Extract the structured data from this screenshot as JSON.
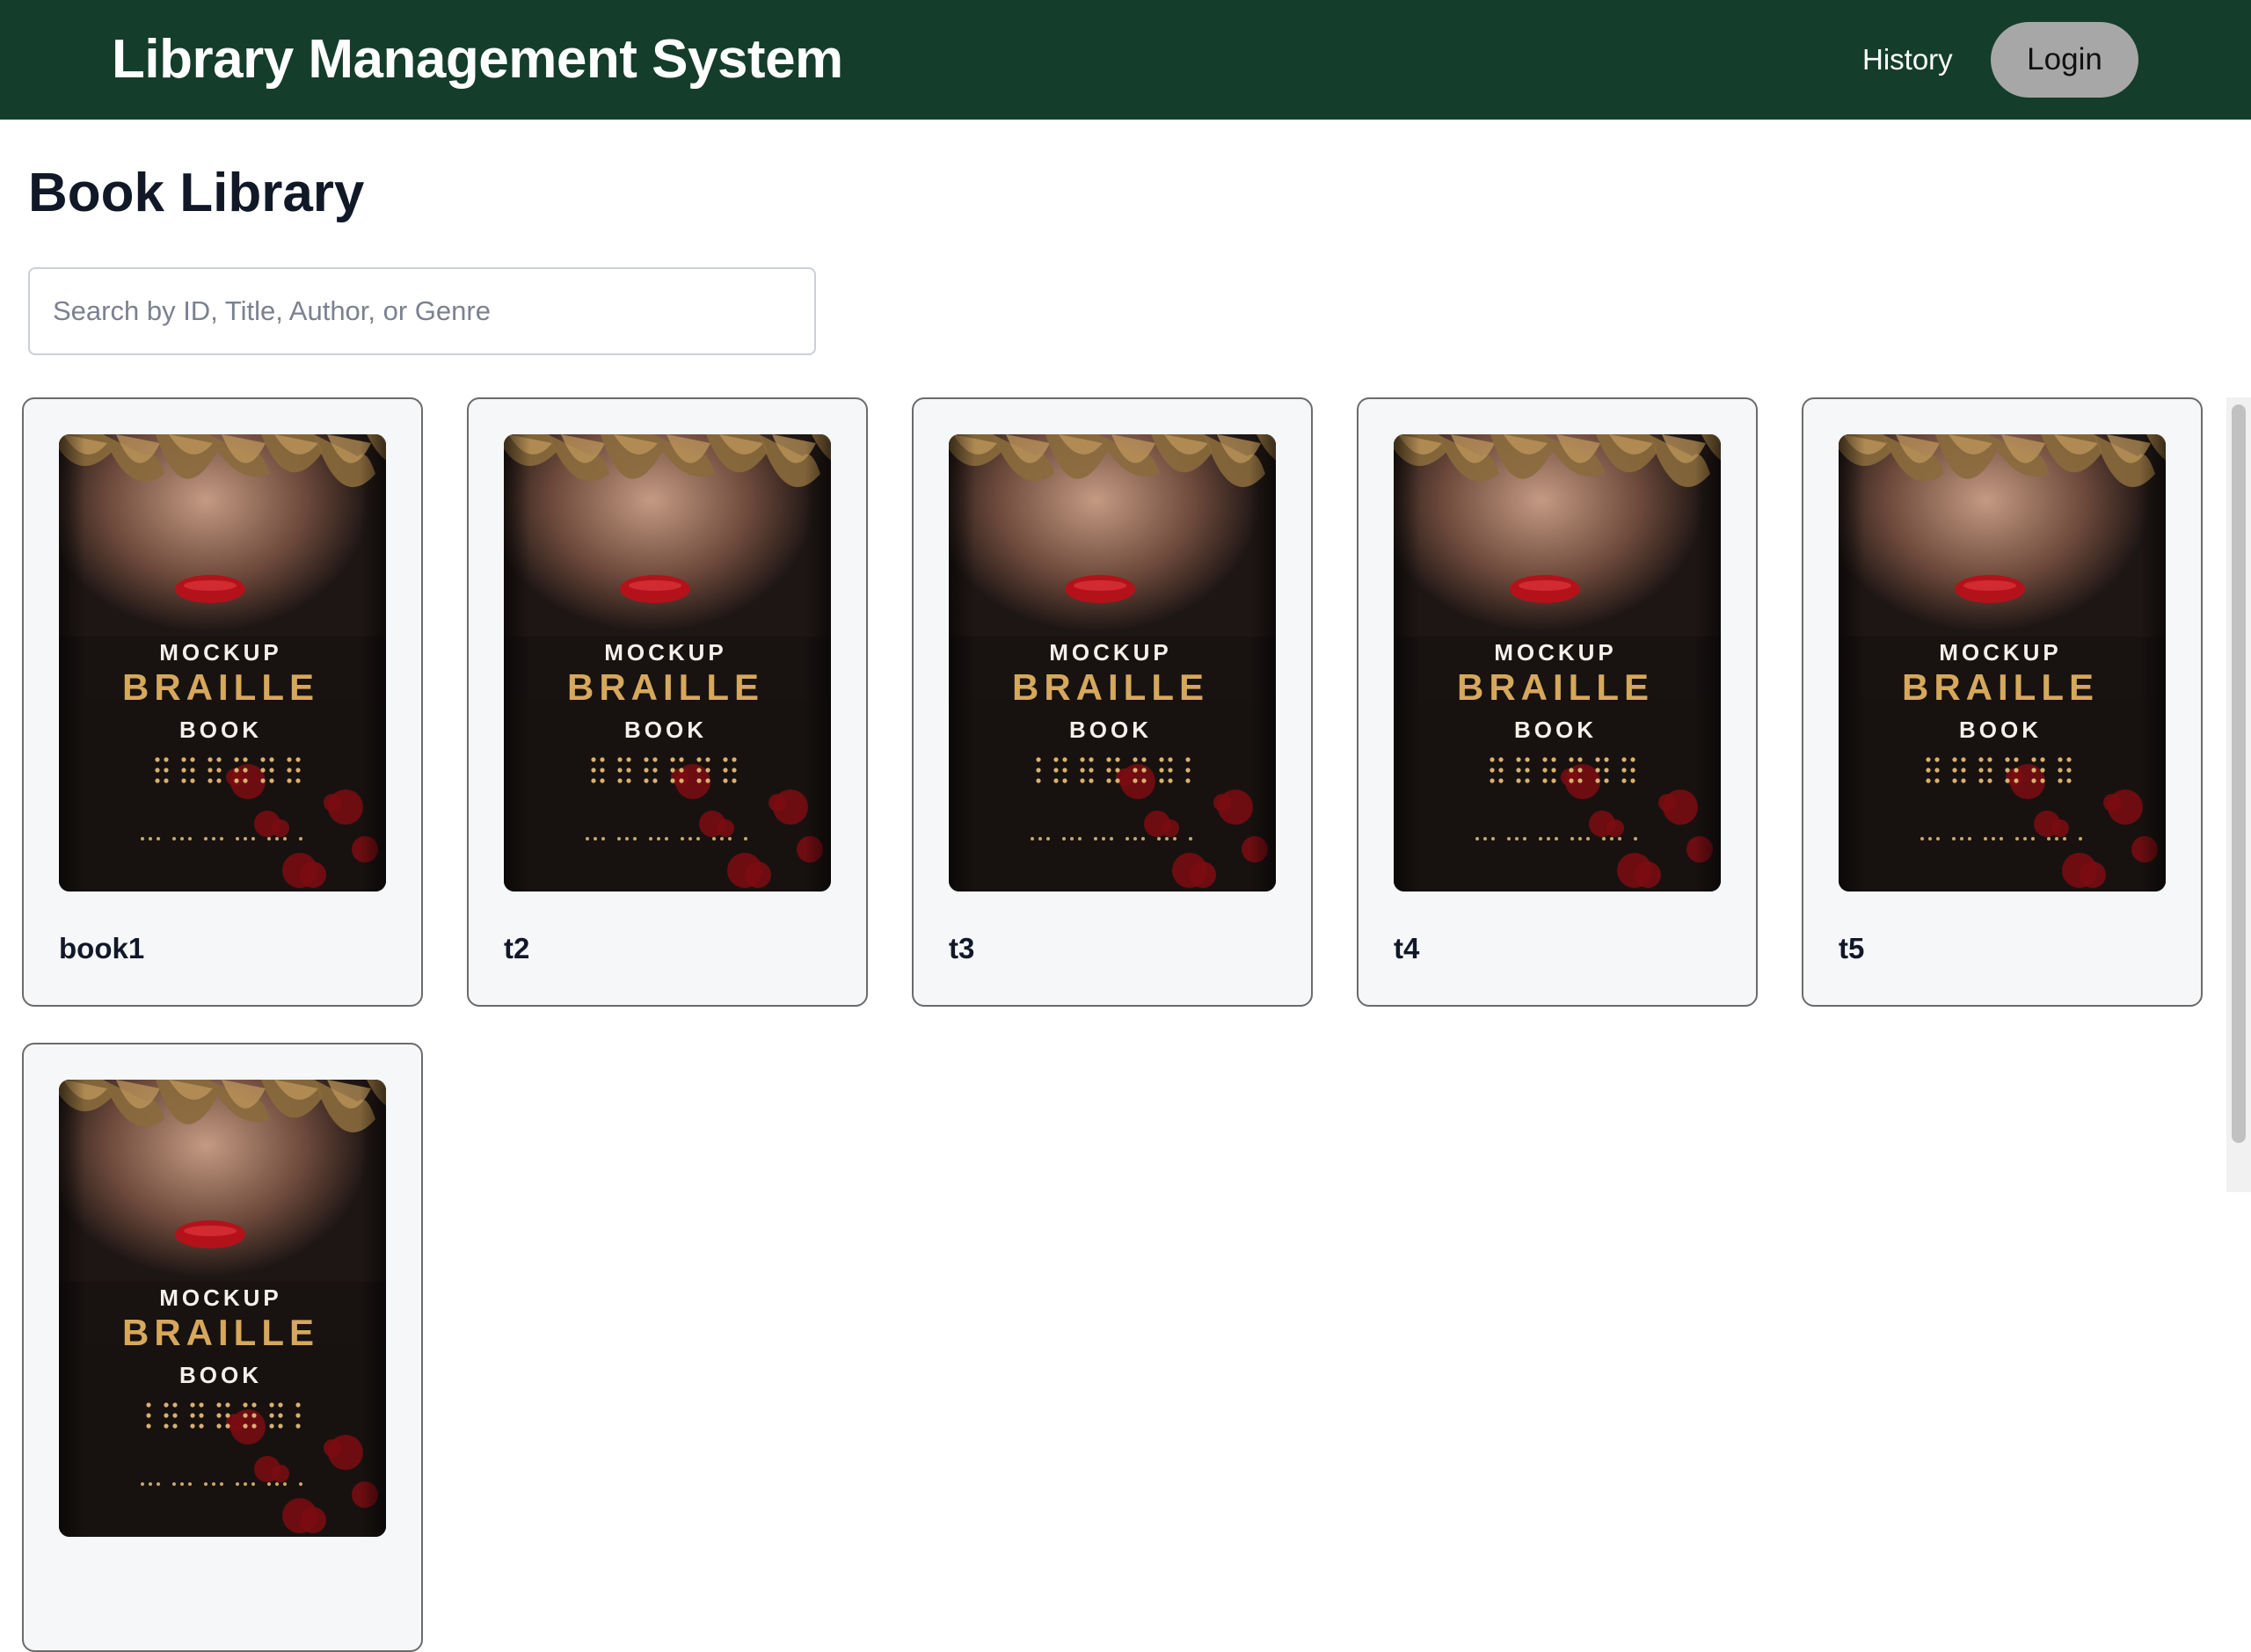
{
  "navbar": {
    "brand": "Library Management System",
    "history_label": "History",
    "login_label": "Login",
    "background": "#143d2b"
  },
  "page": {
    "title": "Book Library"
  },
  "search": {
    "placeholder": "Search by ID, Title, Author, or Genre",
    "value": ""
  },
  "cover": {
    "line1": "MOCKUP",
    "line2": "BRAILLE",
    "line3": "BOOK"
  },
  "books": [
    {
      "title": "book1"
    },
    {
      "title": "t2"
    },
    {
      "title": "t3"
    },
    {
      "title": "t4"
    },
    {
      "title": "t5"
    },
    {
      "title": ""
    }
  ]
}
